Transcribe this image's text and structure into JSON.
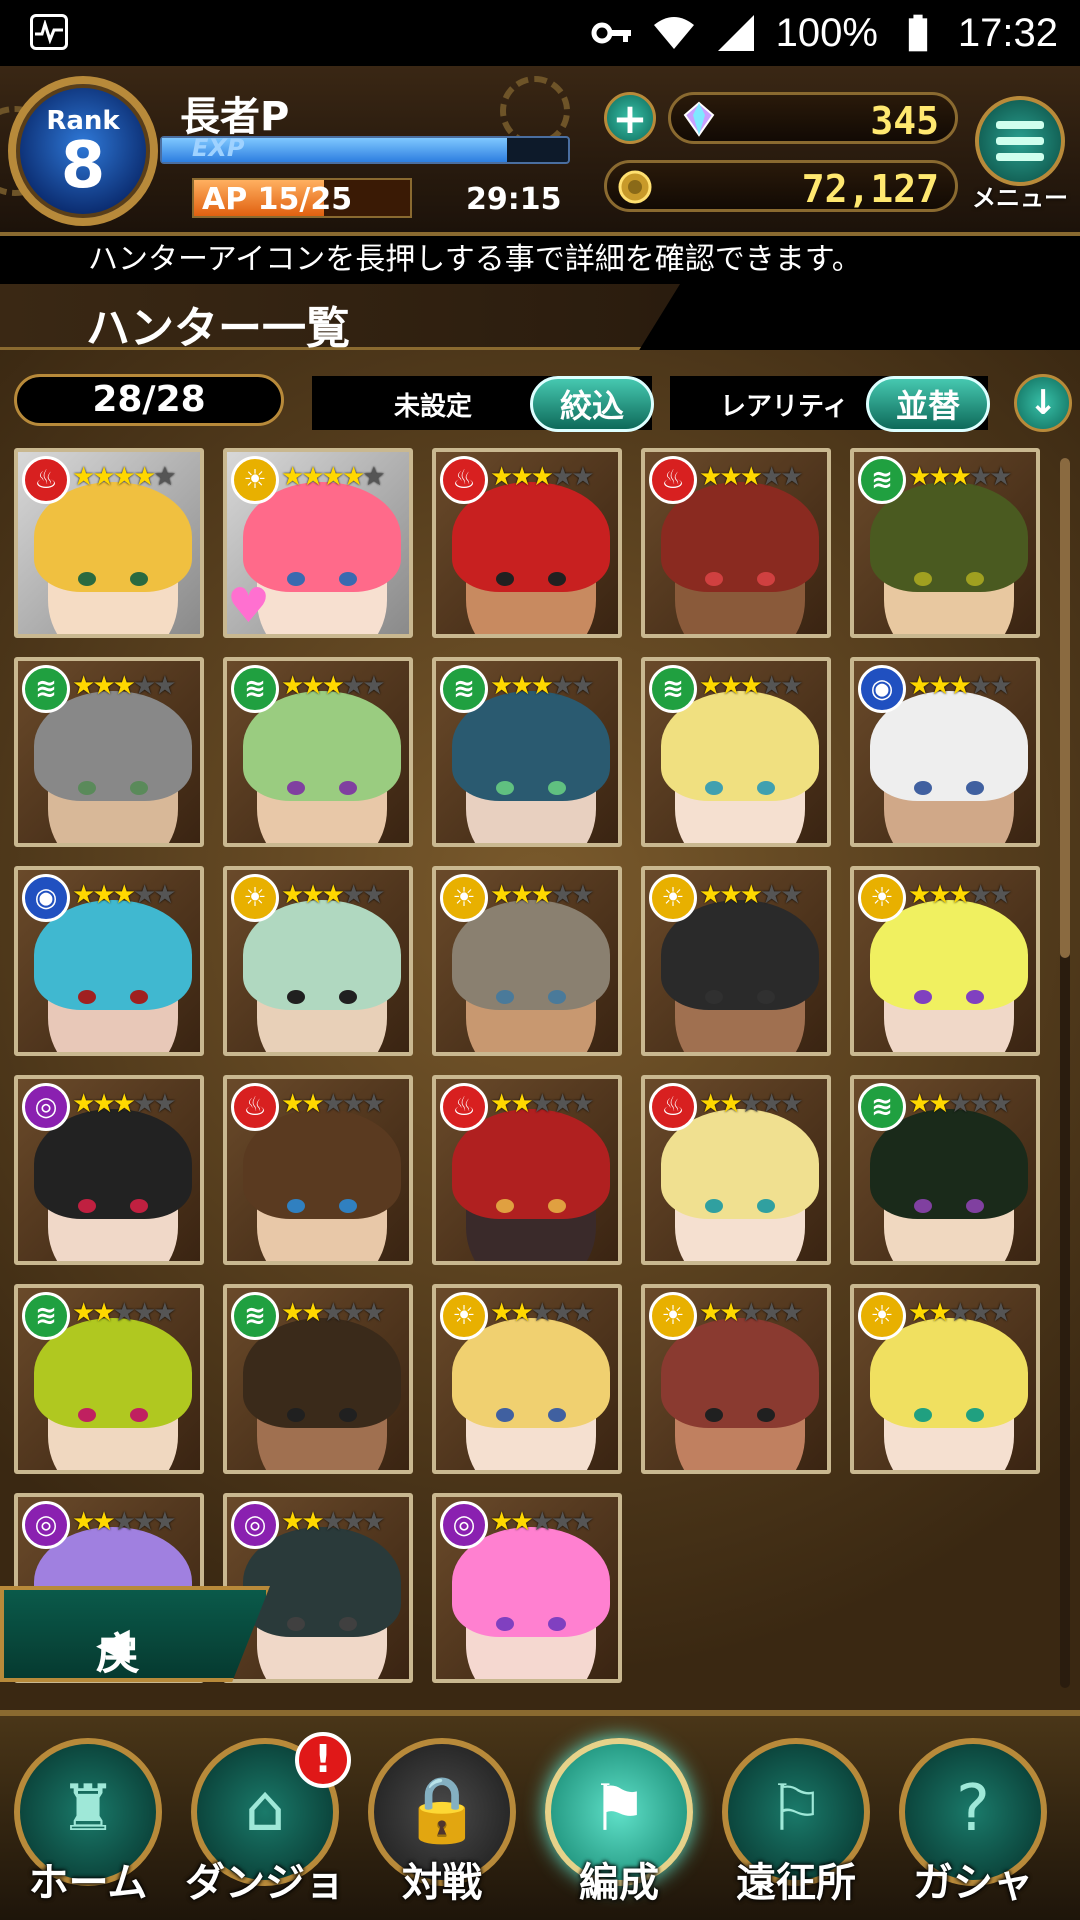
{
  "status_bar": {
    "battery": "100%",
    "time": "17:32"
  },
  "player": {
    "rank_label": "Rank",
    "rank": "8",
    "name": "長者P",
    "exp_label": "EXP",
    "exp_fraction": 0.85,
    "ap_label": "AP 15/25",
    "ap_fraction": 0.6,
    "ap_timer": "29:15"
  },
  "currency": {
    "gems": "345",
    "coins": "72,127"
  },
  "menu_label": "メニュー",
  "hint": "ハンターアイコンを長押しする事で詳細を確認できます。",
  "page_title": "ハンター一覧",
  "count": "28/28",
  "filter": {
    "label": "未設定",
    "button": "絞込"
  },
  "sort": {
    "label": "レアリティ",
    "button": "並替"
  },
  "back_label": "戻る",
  "hunters": [
    {
      "attr": "fire",
      "stars": 4
    },
    {
      "attr": "light",
      "stars": 4
    },
    {
      "attr": "fire",
      "stars": 3
    },
    {
      "attr": "fire",
      "stars": 3
    },
    {
      "attr": "wind",
      "stars": 3
    },
    {
      "attr": "wind",
      "stars": 3
    },
    {
      "attr": "wind",
      "stars": 3
    },
    {
      "attr": "wind",
      "stars": 3
    },
    {
      "attr": "wind",
      "stars": 3
    },
    {
      "attr": "water",
      "stars": 3
    },
    {
      "attr": "water",
      "stars": 3
    },
    {
      "attr": "light",
      "stars": 3
    },
    {
      "attr": "light",
      "stars": 3
    },
    {
      "attr": "light",
      "stars": 3
    },
    {
      "attr": "light",
      "stars": 3
    },
    {
      "attr": "dark",
      "stars": 3
    },
    {
      "attr": "fire",
      "stars": 2
    },
    {
      "attr": "fire",
      "stars": 2
    },
    {
      "attr": "fire",
      "stars": 2
    },
    {
      "attr": "wind",
      "stars": 2
    },
    {
      "attr": "wind",
      "stars": 2
    },
    {
      "attr": "wind",
      "stars": 2
    },
    {
      "attr": "light",
      "stars": 2
    },
    {
      "attr": "light",
      "stars": 2
    },
    {
      "attr": "light",
      "stars": 2
    },
    {
      "attr": "dark",
      "stars": 2
    },
    {
      "attr": "dark",
      "stars": 2
    },
    {
      "attr": "dark",
      "stars": 2
    }
  ],
  "nav": [
    {
      "label": "ホーム",
      "icon": "castle-icon"
    },
    {
      "label": "ダンジョン",
      "icon": "gate-icon",
      "badge": "!"
    },
    {
      "label": "対戦",
      "icon": "lock-icon"
    },
    {
      "label": "編成",
      "icon": "team-icon"
    },
    {
      "label": "遠征所",
      "icon": "flag-icon"
    },
    {
      "label": "ガシャ",
      "icon": "gravestone-icon"
    }
  ],
  "colors": {
    "accent": "#2aa090",
    "gold": "#b88a3a",
    "fire": "#d82020",
    "light": "#e8b000",
    "wind": "#20a040",
    "water": "#2050c0",
    "dark": "#8a20b0"
  }
}
